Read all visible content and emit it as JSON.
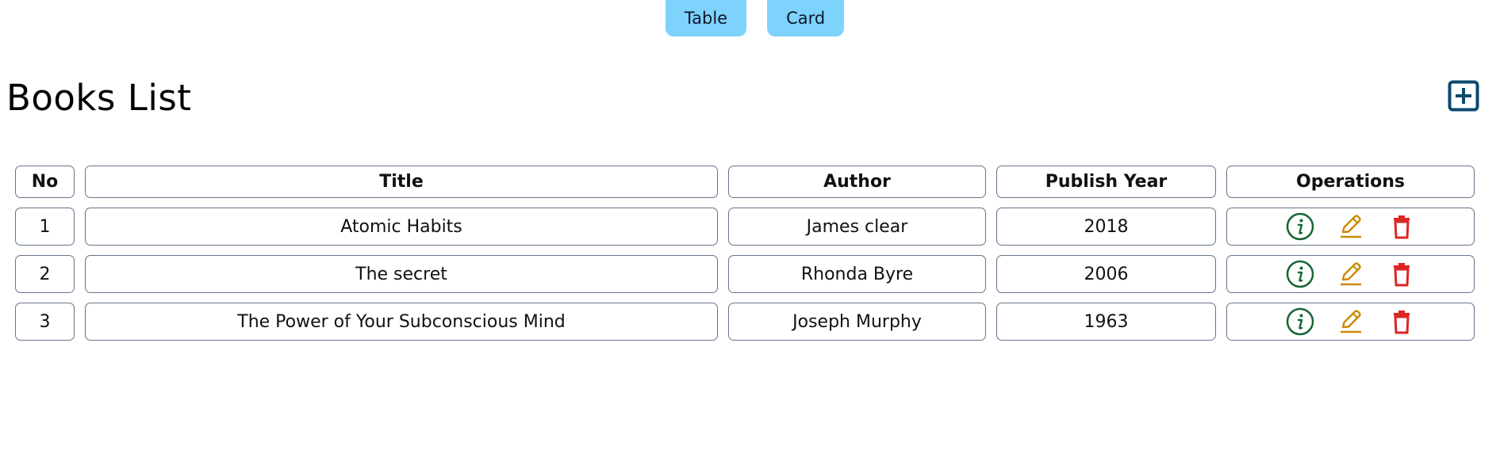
{
  "view_toggle": {
    "table_label": "Table",
    "card_label": "Card"
  },
  "page": {
    "title": "Books List",
    "add_icon": "plus-square-icon"
  },
  "table": {
    "headers": {
      "no": "No",
      "title": "Title",
      "author": "Author",
      "publish_year": "Publish Year",
      "operations": "Operations"
    },
    "rows": [
      {
        "no": "1",
        "title": "Atomic Habits",
        "author": "James clear",
        "publish_year": "2018"
      },
      {
        "no": "2",
        "title": "The secret",
        "author": "Rhonda Byre",
        "publish_year": "2006"
      },
      {
        "no": "3",
        "title": "The Power of Your Subconscious Mind",
        "author": "Joseph Murphy",
        "publish_year": "1963"
      }
    ],
    "operation_icons": [
      "info-circle-icon",
      "edit-pencil-icon",
      "trash-icon"
    ]
  },
  "colors": {
    "toggle_bg": "#7dd3fc",
    "add_icon": "#0c4a6e",
    "info_icon": "#166534",
    "edit_icon": "#ca8a04",
    "delete_icon": "#dc2626",
    "cell_border": "#64748b"
  }
}
